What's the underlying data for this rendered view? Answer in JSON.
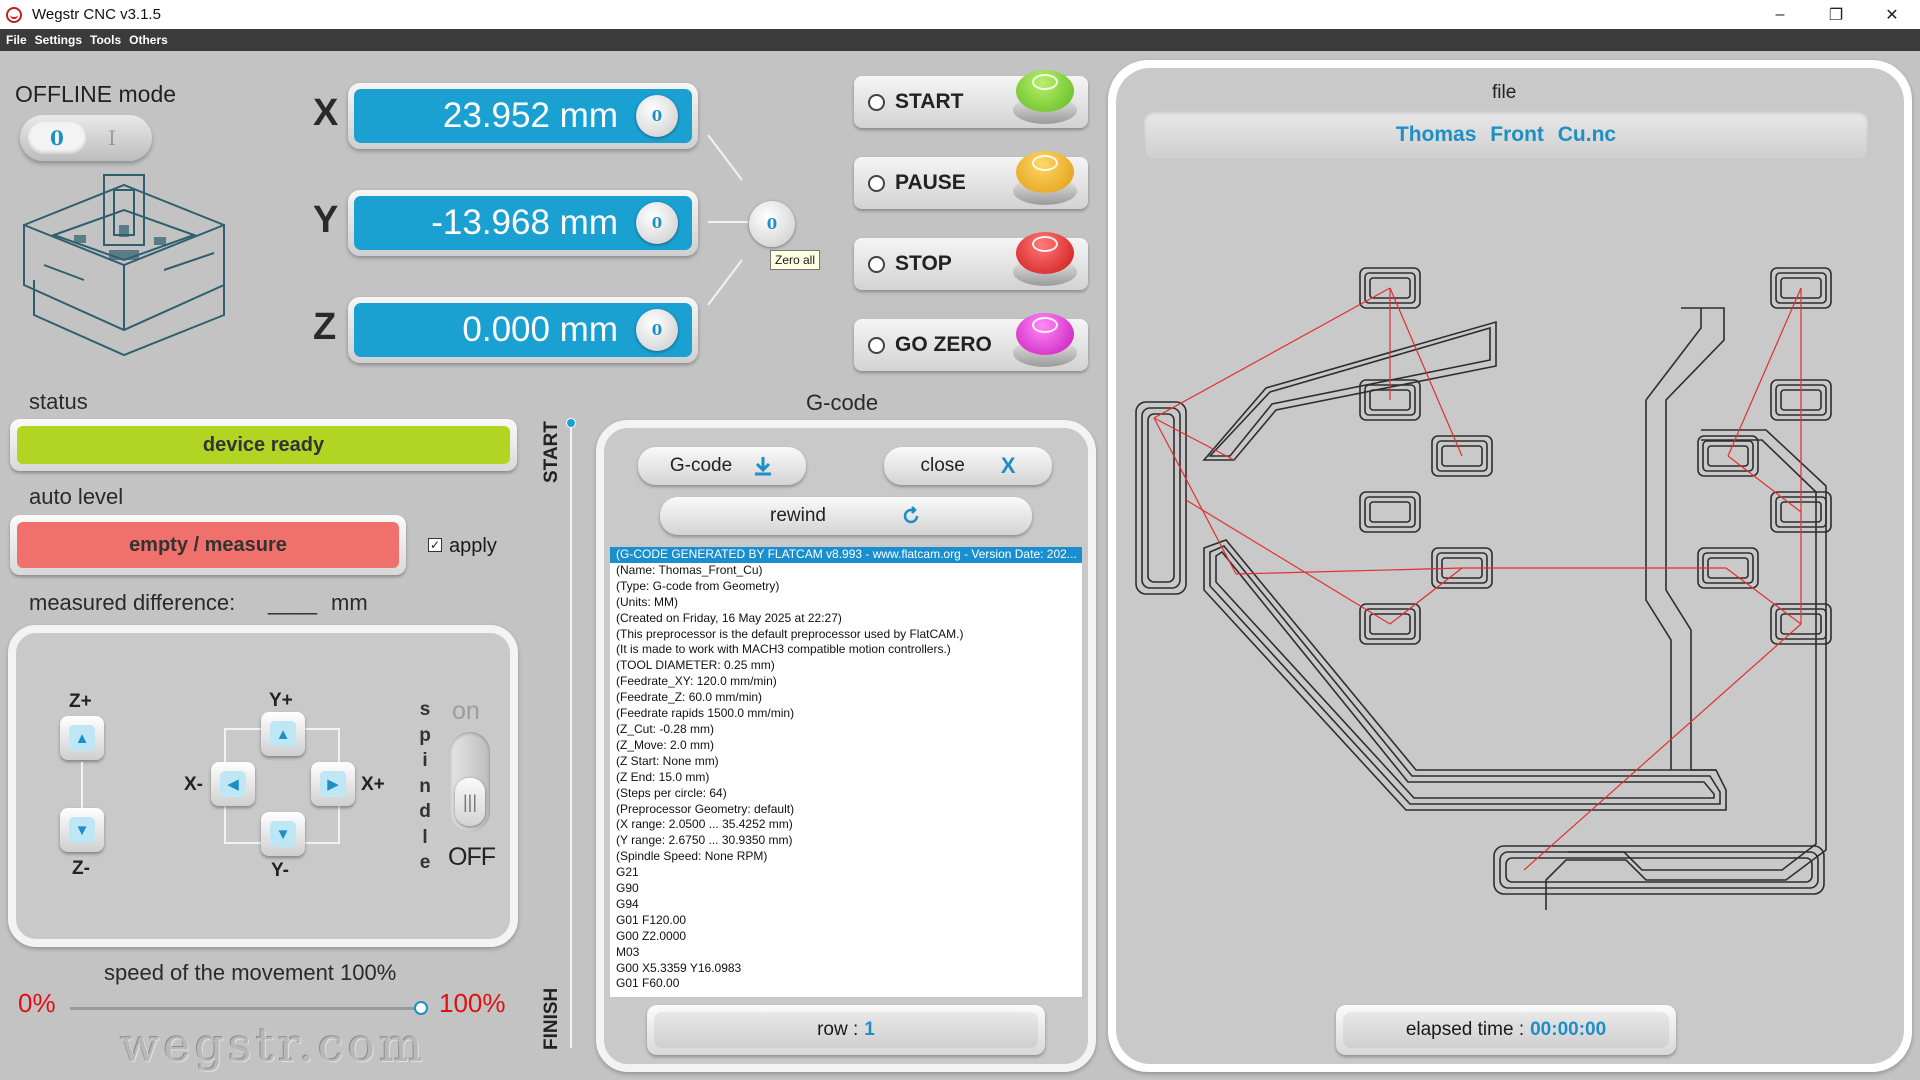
{
  "window": {
    "title": "Wegstr CNC  v3.1.5",
    "minimize": "–",
    "restore": "❐",
    "close": "✕"
  },
  "menu": [
    "File",
    "Settings",
    "Tools",
    "Others"
  ],
  "offline": {
    "label": "OFFLINE mode",
    "toggle_off": "0",
    "toggle_on": "I"
  },
  "axes": [
    {
      "letter": "X",
      "value": "23.952 mm"
    },
    {
      "letter": "Y",
      "value": "-13.968 mm"
    },
    {
      "letter": "Z",
      "value": "0.000 mm"
    }
  ],
  "zero_glyph": "0",
  "zero_all_tooltip": "Zero all",
  "controls": [
    {
      "label": "START",
      "color": "#6ec72a"
    },
    {
      "label": "PAUSE",
      "color": "#e9a418"
    },
    {
      "label": "STOP",
      "color": "#d81e1e"
    },
    {
      "label": "GO ZERO",
      "color": "#d21ec8"
    }
  ],
  "status": {
    "label": "status",
    "value": "device ready"
  },
  "auto_level": {
    "label": "auto level",
    "button": "empty / measure",
    "apply_label": "apply",
    "apply_checked": true
  },
  "measured": {
    "label": "measured difference:",
    "value": "____",
    "unit": "mm"
  },
  "jog": {
    "z_plus": "Z+",
    "z_minus": "Z-",
    "y_plus": "Y+",
    "y_minus": "Y-",
    "x_minus": "X-",
    "x_plus": "X+",
    "spindle_letters": [
      "s",
      "p",
      "i",
      "n",
      "d",
      "l",
      "e"
    ],
    "spindle_on": "on",
    "spindle_off": "OFF"
  },
  "speed": {
    "title": "speed of the movement 100%",
    "min": "0%",
    "max": "100%",
    "value_percent": 100
  },
  "watermark": "wegstr.com",
  "progress_labels": {
    "start": "START",
    "finish": "FINISH"
  },
  "gcode": {
    "title": "G-code",
    "download_label": "G-code",
    "close_label": "close",
    "close_glyph": "X",
    "rewind_label": "rewind",
    "row_label": "row :",
    "row_value": "1",
    "lines": [
      "(G-CODE GENERATED BY FLATCAM v8.993 - www.flatcam.org - Version Date: 202...",
      "(Name: Thomas_Front_Cu)",
      "(Type: G-code from Geometry)",
      "(Units: MM)",
      "(Created on Friday, 16 May 2025 at 22:27)",
      "(This preprocessor is the default preprocessor used by FlatCAM.)",
      "(It is made to work with MACH3 compatible motion controllers.)",
      "(TOOL DIAMETER: 0.25 mm)",
      "(Feedrate_XY: 120.0 mm/min)",
      "(Feedrate_Z: 60.0 mm/min)",
      "(Feedrate rapids 1500.0 mm/min)",
      "(Z_Cut: -0.28 mm)",
      "(Z_Move: 2.0 mm)",
      "(Z Start: None mm)",
      "(Z End: 15.0 mm)",
      "(Steps per circle: 64)",
      "(Preprocessor Geometry: default)",
      "(X range:    2.0500 ...   35.4252  mm)",
      "(Y range:    2.6750 ...   30.9350  mm)",
      "(Spindle Speed: None RPM)",
      "G21",
      "G90",
      "G94",
      "G01 F120.00",
      "G00 Z2.0000",
      "M03",
      "G00 X5.3359 Y16.0983",
      "G01 F60.00"
    ]
  },
  "file": {
    "label": "file",
    "name": "Thomas  Front  Cu.nc"
  },
  "elapsed": {
    "label": "elapsed time :",
    "value": "00:00:00"
  },
  "colors": {
    "accent": "#1d8fc4",
    "axis_bg": "#1ba0d2",
    "status_ok": "#b1d522",
    "autolevel": "#f0706c"
  }
}
